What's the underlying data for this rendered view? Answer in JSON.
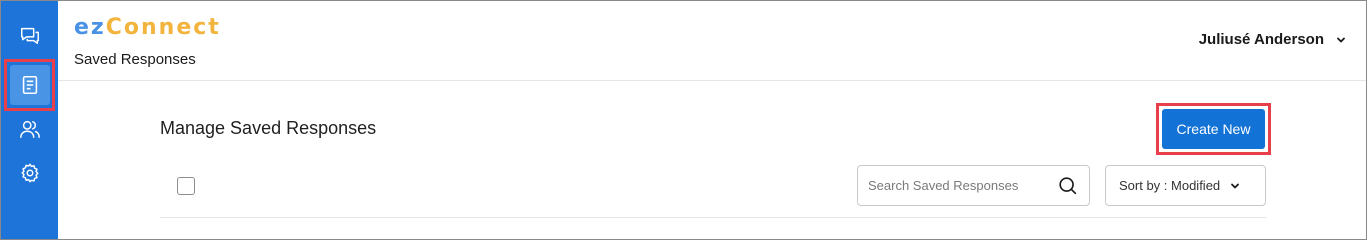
{
  "app": {
    "brand_prefix": "ez",
    "brand_suffix": "Connect",
    "page_title": "Saved Responses"
  },
  "user": {
    "name": "Juliusé Anderson"
  },
  "sidebar": {
    "items": [
      {
        "name": "chat",
        "icon": "chat-bubbles-icon"
      },
      {
        "name": "saved-responses",
        "icon": "document-icon",
        "active": true
      },
      {
        "name": "users",
        "icon": "users-icon"
      },
      {
        "name": "settings",
        "icon": "gear-icon"
      }
    ]
  },
  "main": {
    "title": "Manage Saved Responses",
    "create_button": "Create New",
    "search": {
      "placeholder": "Search Saved Responses",
      "value": ""
    },
    "sort": {
      "label": "Sort by : Modified"
    }
  },
  "colors": {
    "sidebar": "#1e74d8",
    "primary_button": "#1272d6",
    "brand_ez": "#4a92e3",
    "brand_connect": "#f2b43c",
    "highlight": "#e8404a"
  }
}
